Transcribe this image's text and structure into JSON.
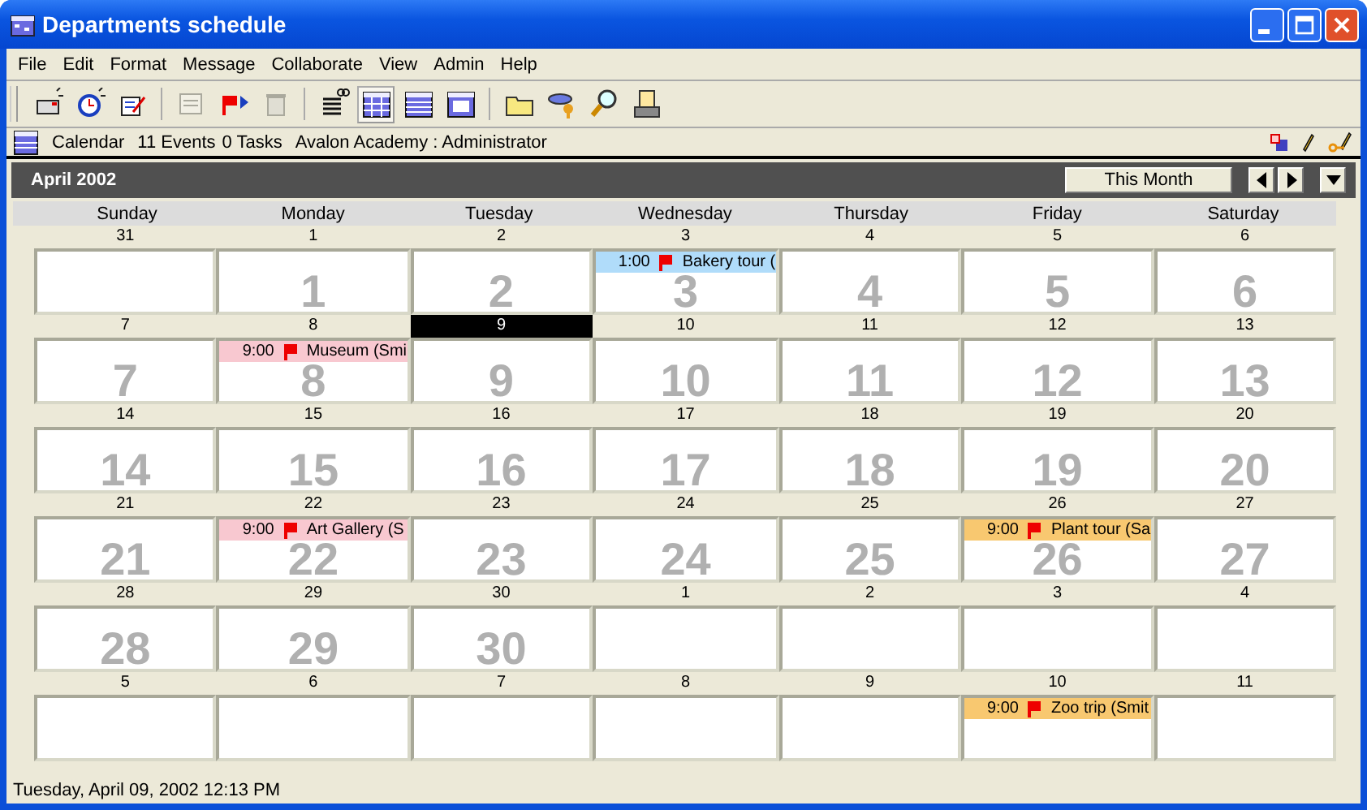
{
  "window": {
    "title": "Departments schedule"
  },
  "menu": [
    "File",
    "Edit",
    "Format",
    "Message",
    "Collaborate",
    "View",
    "Admin",
    "Help"
  ],
  "toolbar_groups": [
    [
      {
        "kind": "new-message",
        "disabled": false,
        "selected": false
      },
      {
        "kind": "alarm",
        "disabled": false,
        "selected": false
      },
      {
        "kind": "new-task",
        "disabled": false,
        "selected": false
      }
    ],
    [
      {
        "kind": "print-form",
        "disabled": true,
        "selected": false
      },
      {
        "kind": "flag-forward",
        "disabled": false,
        "selected": false
      },
      {
        "kind": "trash",
        "disabled": true,
        "selected": false
      }
    ],
    [
      {
        "kind": "list",
        "disabled": false,
        "selected": false
      },
      {
        "kind": "month",
        "disabled": false,
        "selected": true
      },
      {
        "kind": "week",
        "disabled": false,
        "selected": false
      },
      {
        "kind": "day",
        "disabled": false,
        "selected": false
      }
    ],
    [
      {
        "kind": "folder",
        "disabled": false,
        "selected": false
      },
      {
        "kind": "key",
        "disabled": false,
        "selected": false
      },
      {
        "kind": "search",
        "disabled": false,
        "selected": false
      },
      {
        "kind": "printer",
        "disabled": false,
        "selected": false
      }
    ]
  ],
  "info_bar": {
    "view": "Calendar",
    "events": "11 Events",
    "tasks": "0 Tasks",
    "account": "Avalon Academy : Administrator"
  },
  "calendar": {
    "title": "April 2002",
    "today_button": "This Month",
    "weekdays": [
      "Sunday",
      "Monday",
      "Tuesday",
      "Wednesday",
      "Thursday",
      "Friday",
      "Saturday"
    ],
    "weeks": [
      {
        "days": [
          {
            "number": "31",
            "selected": false
          },
          {
            "number": "1",
            "selected": false,
            "watermark": "1"
          },
          {
            "number": "2",
            "selected": false,
            "watermark": "2"
          },
          {
            "number": "3",
            "selected": false,
            "watermark": "3",
            "events": [
              {
                "time": "1:00",
                "title": "Bakery tour (",
                "color": "#b0dcfa"
              }
            ]
          },
          {
            "number": "4",
            "selected": false,
            "watermark": "4"
          },
          {
            "number": "5",
            "selected": false,
            "watermark": "5"
          },
          {
            "number": "6",
            "selected": false,
            "watermark": "6"
          }
        ]
      },
      {
        "days": [
          {
            "number": "7",
            "selected": false,
            "watermark": "7"
          },
          {
            "number": "8",
            "selected": false,
            "watermark": "8",
            "events": [
              {
                "time": "9:00",
                "title": "Museum (Smi",
                "color": "#f8c8d0"
              }
            ]
          },
          {
            "number": "9",
            "selected": true,
            "watermark": "9"
          },
          {
            "number": "10",
            "selected": false,
            "watermark": "10"
          },
          {
            "number": "11",
            "selected": false,
            "watermark": "11"
          },
          {
            "number": "12",
            "selected": false,
            "watermark": "12"
          },
          {
            "number": "13",
            "selected": false,
            "watermark": "13"
          }
        ]
      },
      {
        "days": [
          {
            "number": "14",
            "selected": false,
            "watermark": "14"
          },
          {
            "number": "15",
            "selected": false,
            "watermark": "15"
          },
          {
            "number": "16",
            "selected": false,
            "watermark": "16"
          },
          {
            "number": "17",
            "selected": false,
            "watermark": "17"
          },
          {
            "number": "18",
            "selected": false,
            "watermark": "18"
          },
          {
            "number": "19",
            "selected": false,
            "watermark": "19"
          },
          {
            "number": "20",
            "selected": false,
            "watermark": "20"
          }
        ]
      },
      {
        "days": [
          {
            "number": "21",
            "selected": false,
            "watermark": "21"
          },
          {
            "number": "22",
            "selected": false,
            "watermark": "22",
            "events": [
              {
                "time": "9:00",
                "title": "Art Gallery (S",
                "color": "#f8c8d0"
              }
            ]
          },
          {
            "number": "23",
            "selected": false,
            "watermark": "23"
          },
          {
            "number": "24",
            "selected": false,
            "watermark": "24"
          },
          {
            "number": "25",
            "selected": false,
            "watermark": "25"
          },
          {
            "number": "26",
            "selected": false,
            "watermark": "26",
            "events": [
              {
                "time": "9:00",
                "title": "Plant tour (Sa",
                "color": "#f8c870"
              }
            ]
          },
          {
            "number": "27",
            "selected": false,
            "watermark": "27"
          }
        ]
      },
      {
        "days": [
          {
            "number": "28",
            "selected": false,
            "watermark": "28"
          },
          {
            "number": "29",
            "selected": false,
            "watermark": "29"
          },
          {
            "number": "30",
            "selected": false,
            "watermark": "30"
          },
          {
            "number": "1",
            "selected": false
          },
          {
            "number": "2",
            "selected": false
          },
          {
            "number": "3",
            "selected": false
          },
          {
            "number": "4",
            "selected": false
          }
        ]
      },
      {
        "days": [
          {
            "number": "5",
            "selected": false
          },
          {
            "number": "6",
            "selected": false
          },
          {
            "number": "7",
            "selected": false
          },
          {
            "number": "8",
            "selected": false
          },
          {
            "number": "9",
            "selected": false
          },
          {
            "number": "10",
            "selected": false,
            "events": [
              {
                "time": "9:00",
                "title": "Zoo trip (Smit",
                "color": "#f8c870"
              }
            ]
          },
          {
            "number": "11",
            "selected": false
          }
        ]
      }
    ]
  },
  "status_bar": "Tuesday, April 09, 2002 12:13 PM"
}
